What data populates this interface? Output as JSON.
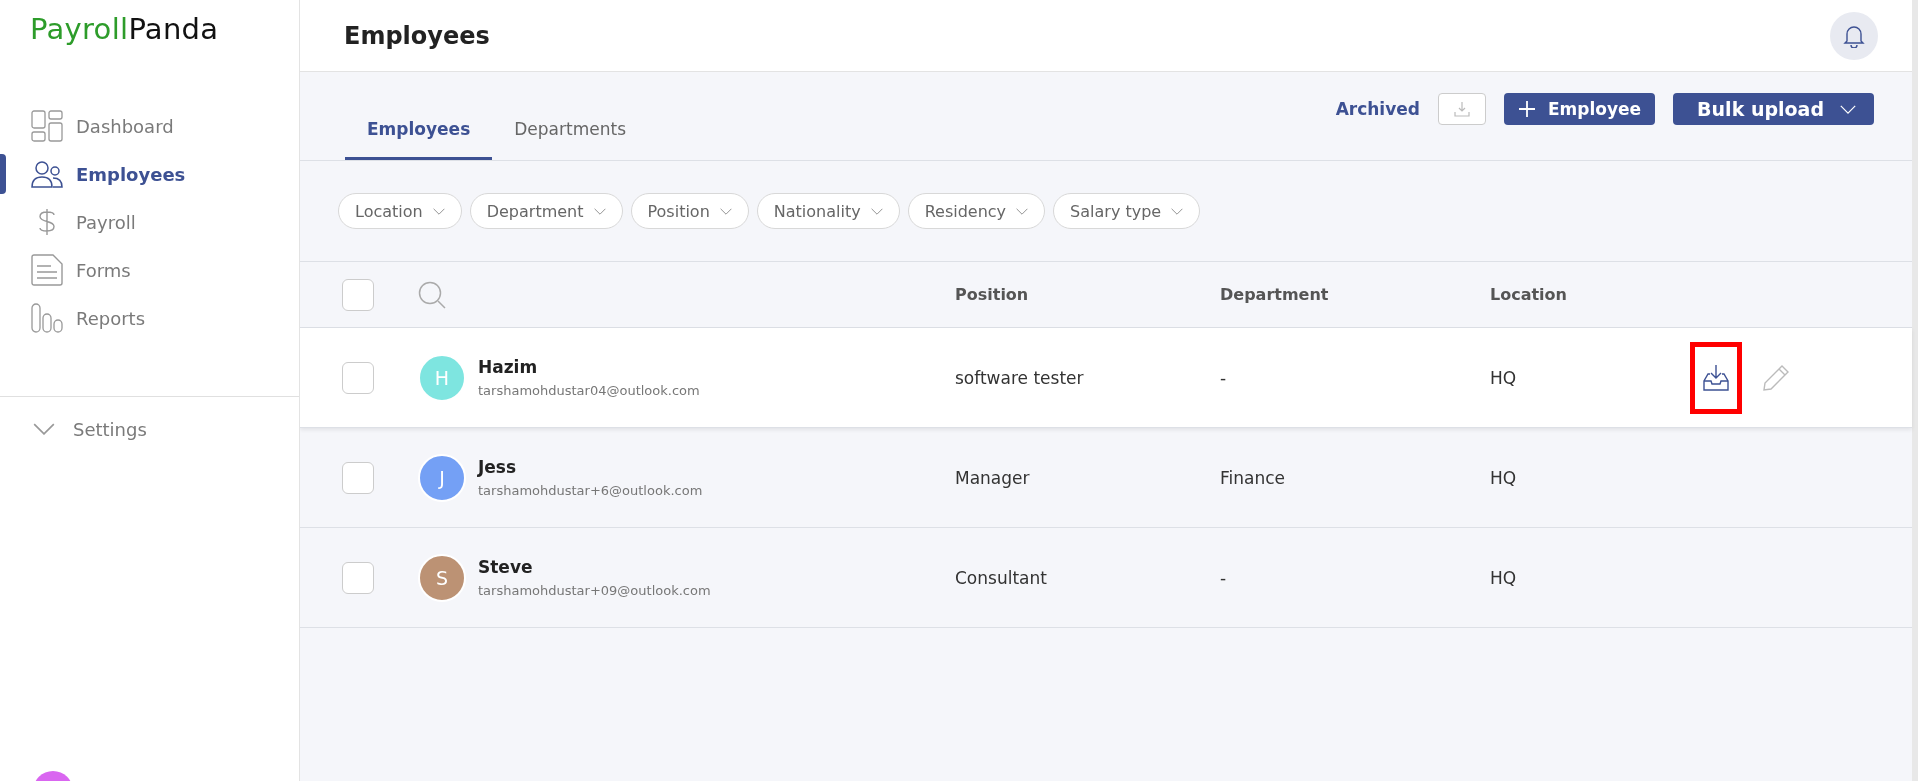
{
  "brand": {
    "part1": "Payroll",
    "part2": "Panda"
  },
  "sidebar": {
    "items": [
      {
        "label": "Dashboard",
        "selected": false
      },
      {
        "label": "Employees",
        "selected": true
      },
      {
        "label": "Payroll",
        "selected": false
      },
      {
        "label": "Forms",
        "selected": false
      },
      {
        "label": "Reports",
        "selected": false
      }
    ],
    "settings": {
      "label": "Settings",
      "expanded": false
    }
  },
  "header": {
    "title": "Employees"
  },
  "tabs": [
    {
      "label": "Employees",
      "selected": true
    },
    {
      "label": "Departments",
      "selected": false
    }
  ],
  "actions": {
    "archived": "Archived",
    "add_employee": "Employee",
    "bulk_upload": "Bulk upload"
  },
  "filters": [
    "Location",
    "Department",
    "Position",
    "Nationality",
    "Residency",
    "Salary type"
  ],
  "table": {
    "columns": [
      "Position",
      "Department",
      "Location"
    ],
    "all_checked": false,
    "rows": [
      {
        "initial": "H",
        "name": "Hazim",
        "email": "tarshamohdustar04@outlook.com",
        "position": "software tester",
        "department": "-",
        "location": "HQ",
        "color": "#7ee5e0",
        "checked": false,
        "hovered": true,
        "archive_highlighted": true
      },
      {
        "initial": "J",
        "name": "Jess",
        "email": "tarshamohdustar+6@outlook.com",
        "position": "Manager",
        "department": "Finance",
        "location": "HQ",
        "color": "#74a0f5",
        "checked": false,
        "hovered": false,
        "archive_highlighted": false
      },
      {
        "initial": "S",
        "name": "Steve",
        "email": "tarshamohdustar+09@outlook.com",
        "position": "Consultant",
        "department": "-",
        "location": "HQ",
        "color": "#bc9274",
        "checked": false,
        "hovered": false,
        "archive_highlighted": false
      }
    ]
  }
}
